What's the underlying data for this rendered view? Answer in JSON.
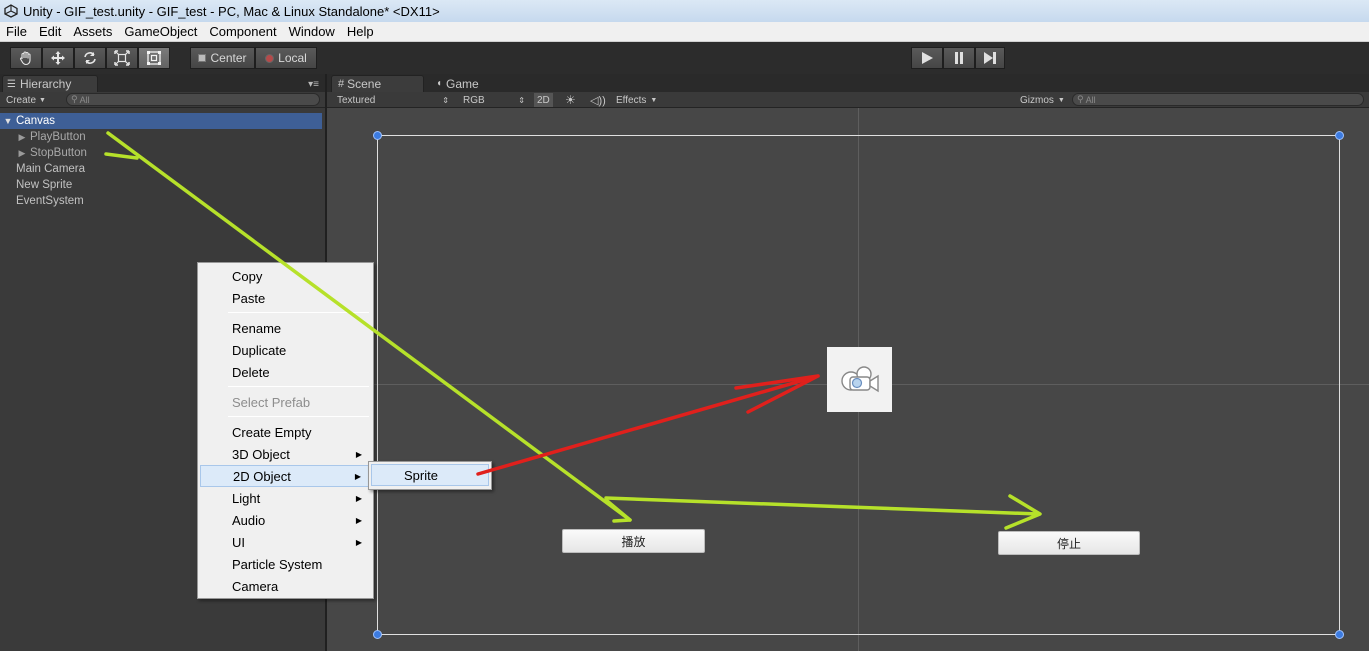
{
  "window": {
    "title": "Unity - GIF_test.unity - GIF_test - PC, Mac & Linux Standalone* <DX11>"
  },
  "menubar": [
    "File",
    "Edit",
    "Assets",
    "GameObject",
    "Component",
    "Window",
    "Help"
  ],
  "toolbar": {
    "tools": [
      "hand-icon",
      "move-icon",
      "rotate-icon",
      "scale-icon",
      "rect-icon"
    ],
    "pivot_label": "Center",
    "space_label": "Local",
    "play_controls": [
      "play-icon",
      "pause-icon",
      "step-icon"
    ]
  },
  "hierarchy": {
    "tab_label": "Hierarchy",
    "create_label": "Create",
    "search_placeholder": "All",
    "items": [
      {
        "label": "Canvas",
        "selected": true
      },
      {
        "label": "PlayButton"
      },
      {
        "label": "StopButton"
      },
      {
        "label": "Main Camera"
      },
      {
        "label": "New Sprite"
      },
      {
        "label": "EventSystem"
      }
    ]
  },
  "scene": {
    "tabs": [
      {
        "label": "Scene",
        "active": true
      },
      {
        "label": "Game"
      }
    ],
    "toolbar": {
      "render_mode": "Textured",
      "color_mode": "RGB",
      "mode_2d": "2D",
      "effects_label": "Effects",
      "gizmos_label": "Gizmos",
      "search_placeholder": "All"
    },
    "buttons": {
      "play_label": "播放",
      "stop_label": "停止"
    }
  },
  "context_menu": {
    "copy": "Copy",
    "paste": "Paste",
    "rename": "Rename",
    "duplicate": "Duplicate",
    "delete": "Delete",
    "select_prefab": "Select Prefab",
    "create_empty": "Create Empty",
    "object_3d": "3D Object",
    "object_2d": "2D Object",
    "light": "Light",
    "audio": "Audio",
    "ui": "UI",
    "particle_system": "Particle System",
    "camera": "Camera",
    "submenu_sprite": "Sprite"
  },
  "colors": {
    "selection": "#3e5f96",
    "arrow_green": "#b6e12a",
    "arrow_red": "#e0201c",
    "handle_blue": "#3c7be0"
  }
}
